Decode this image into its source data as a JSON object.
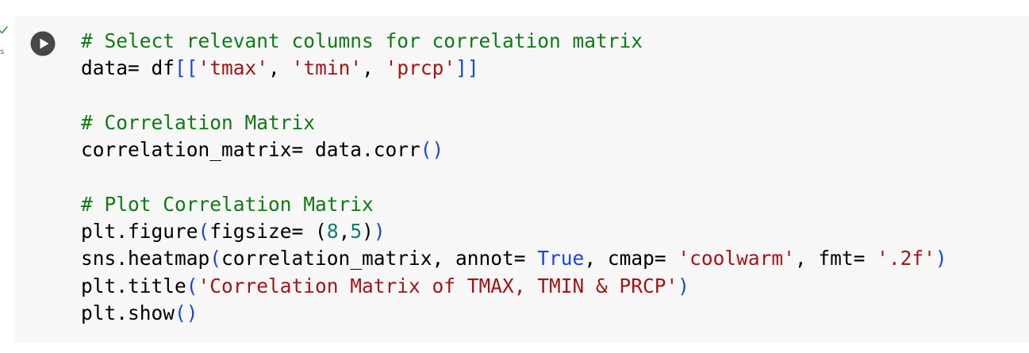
{
  "gutter": {
    "exec_time": "s",
    "status_icon": "check-icon",
    "status_color": "#2e9d3a"
  },
  "cell": {
    "run_icon": "play-icon",
    "lines": [
      [
        {
          "t": "# Select relevant columns for correlation matrix",
          "k": "com"
        }
      ],
      [
        {
          "t": "data= df",
          "k": "txt"
        },
        {
          "t": "[[",
          "k": "br"
        },
        {
          "t": "'tmax'",
          "k": "str"
        },
        {
          "t": ", ",
          "k": "txt"
        },
        {
          "t": "'tmin'",
          "k": "str"
        },
        {
          "t": ", ",
          "k": "txt"
        },
        {
          "t": "'prcp'",
          "k": "str"
        },
        {
          "t": "]]",
          "k": "br"
        }
      ],
      [],
      [
        {
          "t": "# Correlation Matrix",
          "k": "com"
        }
      ],
      [
        {
          "t": "correlation_matrix= data.corr",
          "k": "txt"
        },
        {
          "t": "()",
          "k": "br"
        }
      ],
      [],
      [
        {
          "t": "# Plot Correlation Matrix",
          "k": "com"
        }
      ],
      [
        {
          "t": "plt.figure",
          "k": "txt"
        },
        {
          "t": "(",
          "k": "br"
        },
        {
          "t": "figsize= ",
          "k": "txt"
        },
        {
          "t": "(",
          "k": "txt"
        },
        {
          "t": "8",
          "k": "num"
        },
        {
          "t": ",",
          "k": "txt"
        },
        {
          "t": "5",
          "k": "num"
        },
        {
          "t": ")",
          "k": "txt"
        },
        {
          "t": ")",
          "k": "br"
        }
      ],
      [
        {
          "t": "sns.heatmap",
          "k": "txt"
        },
        {
          "t": "(",
          "k": "br"
        },
        {
          "t": "correlation_matrix, annot= ",
          "k": "txt"
        },
        {
          "t": "True",
          "k": "kw"
        },
        {
          "t": ", cmap= ",
          "k": "txt"
        },
        {
          "t": "'coolwarm'",
          "k": "str"
        },
        {
          "t": ", fmt= ",
          "k": "txt"
        },
        {
          "t": "'.2f'",
          "k": "str"
        },
        {
          "t": ")",
          "k": "br"
        }
      ],
      [
        {
          "t": "plt.title",
          "k": "txt"
        },
        {
          "t": "(",
          "k": "br"
        },
        {
          "t": "'Correlation Matrix of TMAX, TMIN & PRCP'",
          "k": "str"
        },
        {
          "t": ")",
          "k": "br"
        }
      ],
      [
        {
          "t": "plt.show",
          "k": "txt"
        },
        {
          "t": "()",
          "k": "br"
        }
      ]
    ]
  }
}
